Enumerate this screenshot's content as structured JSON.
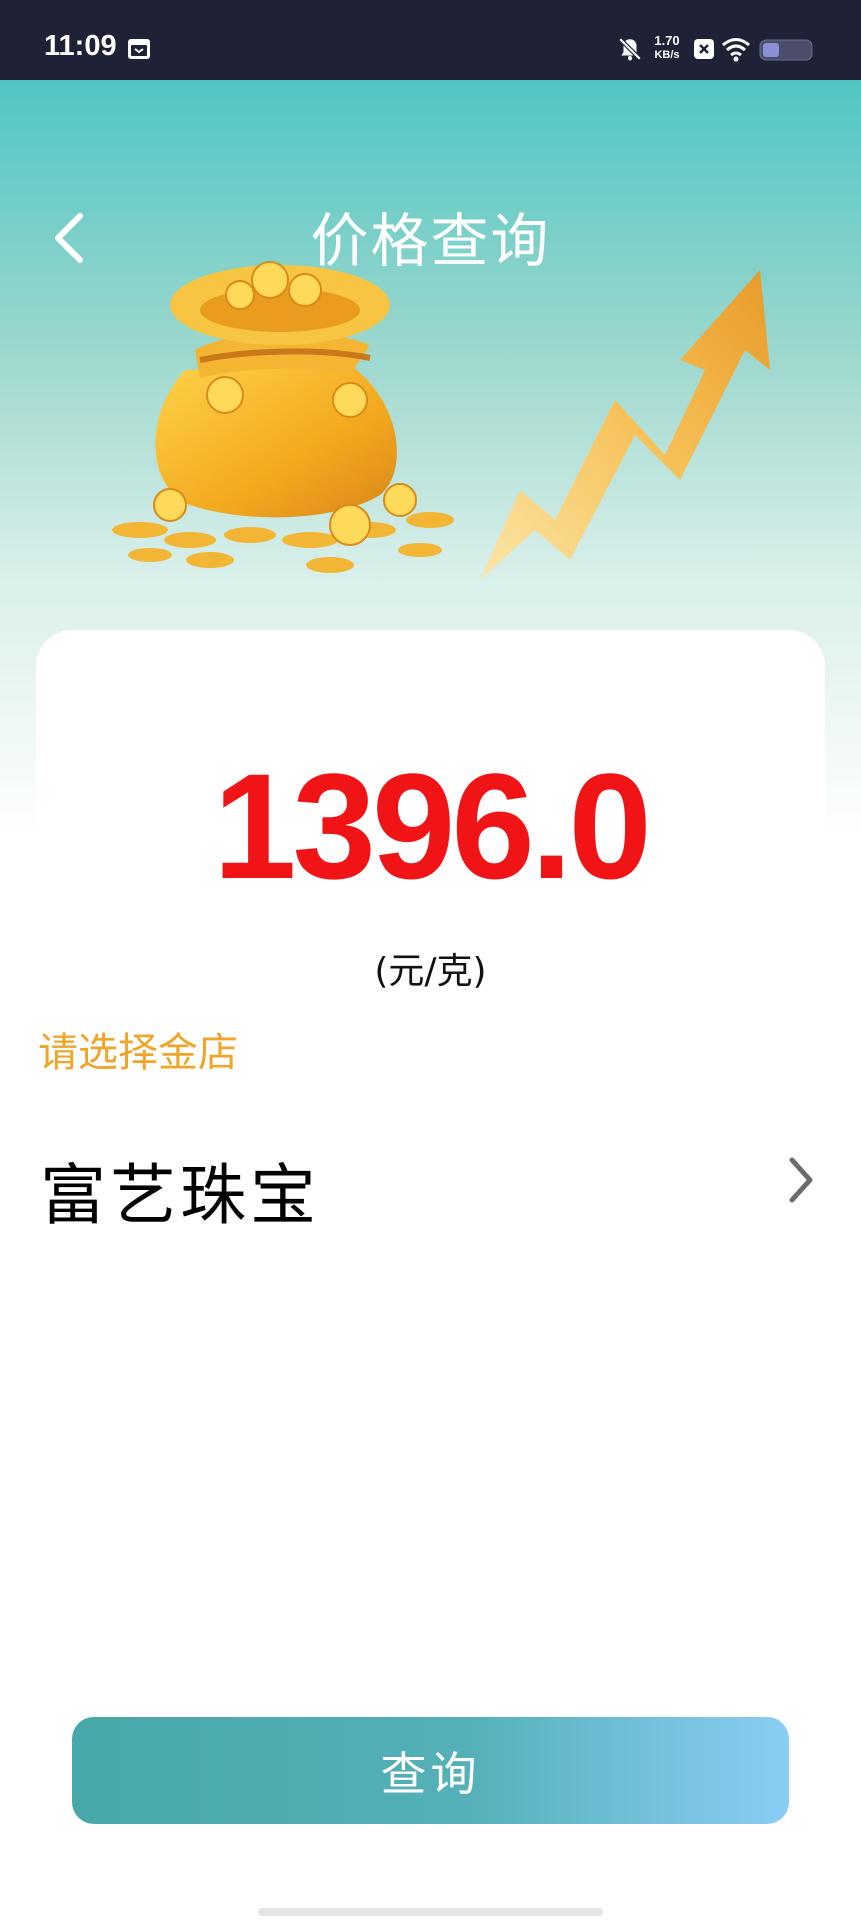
{
  "status_bar": {
    "time": "11:09",
    "net_speed_value": "1.70",
    "net_speed_unit": "KB/s"
  },
  "header": {
    "title": "价格查询"
  },
  "price": {
    "value": "1396.0",
    "unit": "(元/克)",
    "color": "#f01417"
  },
  "store": {
    "prompt": "请选择金店",
    "name": "富艺珠宝"
  },
  "actions": {
    "query_label": "查询"
  },
  "colors": {
    "accent_teal": "#4fc6c4",
    "prompt_orange": "#efa52a",
    "button_start": "#47a8a9",
    "button_end": "#89cdf4"
  }
}
